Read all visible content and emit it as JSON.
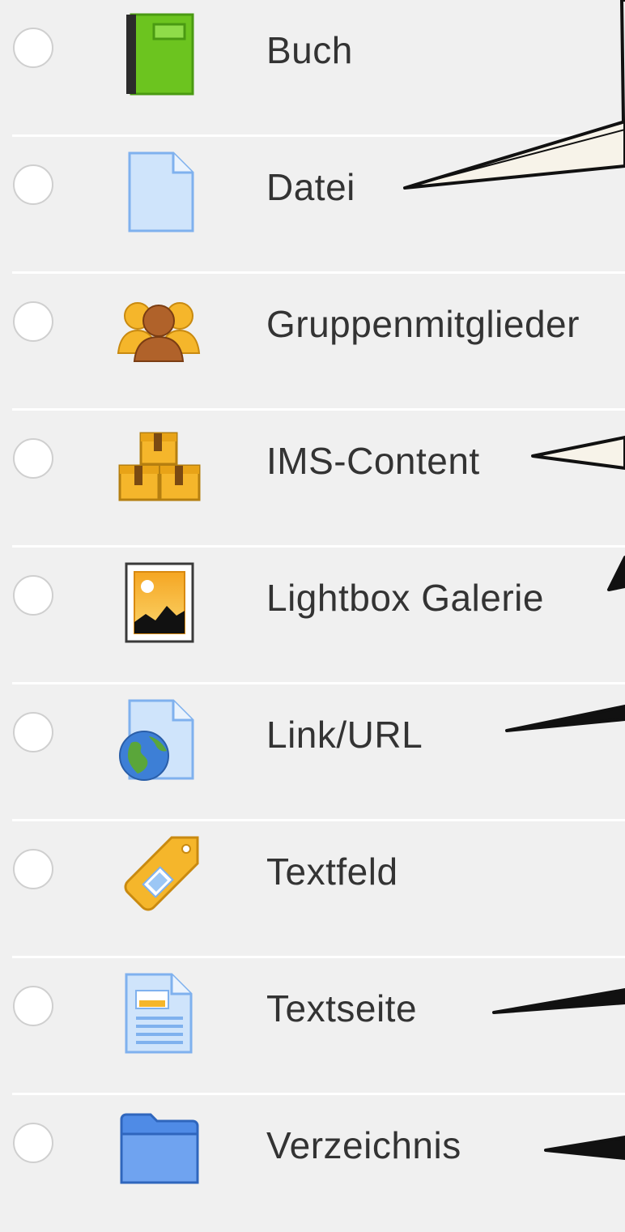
{
  "activity_list": {
    "items": [
      {
        "label": "Buch",
        "icon": "book-icon",
        "selected": false
      },
      {
        "label": "Datei",
        "icon": "file-icon",
        "selected": false
      },
      {
        "label": "Gruppenmitglieder",
        "icon": "group-members-icon",
        "selected": false
      },
      {
        "label": "IMS-Content",
        "icon": "ims-content-packages-icon",
        "selected": false
      },
      {
        "label": "Lightbox Galerie",
        "icon": "image-gallery-icon",
        "selected": false
      },
      {
        "label": "Link/URL",
        "icon": "url-globe-icon",
        "selected": false
      },
      {
        "label": "Textfeld",
        "icon": "label-tag-icon",
        "selected": false
      },
      {
        "label": "Textseite",
        "icon": "page-icon",
        "selected": false
      },
      {
        "label": "Verzeichnis",
        "icon": "folder-icon",
        "selected": false
      }
    ]
  },
  "colors": {
    "background": "#f0f0f0",
    "divider": "#ffffff",
    "text": "#333333",
    "radio_border": "#cfcfcf",
    "annotation_stroke": "#111111",
    "callout_fill": "#f7f3e9"
  }
}
